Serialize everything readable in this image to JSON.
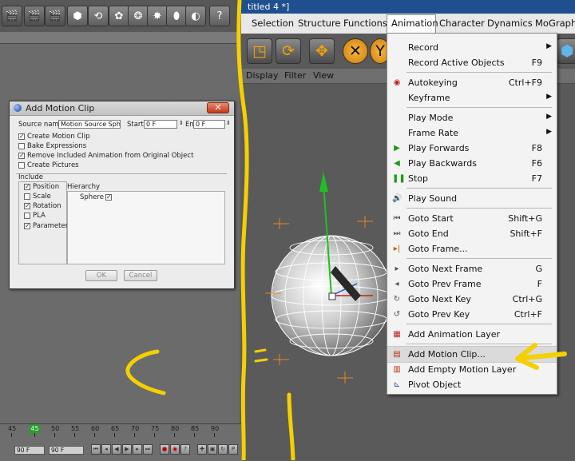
{
  "window": {
    "title_fragment": "titled 4 *]"
  },
  "menubar": {
    "items": [
      "Selection",
      "Structure",
      "Functions",
      "Animation",
      "Character",
      "Dynamics",
      "MoGraph"
    ]
  },
  "viewport_menu": {
    "items": [
      "Display",
      "Filter",
      "View"
    ]
  },
  "animation_menu": {
    "items": [
      {
        "label": "Record",
        "shortcut": "",
        "submenu": true,
        "icon": ""
      },
      {
        "label": "Record Active Objects",
        "shortcut": "F9",
        "submenu": false,
        "icon": ""
      },
      {
        "label": "Autokeying",
        "shortcut": "Ctrl+F9",
        "submenu": false,
        "icon": "autokey-icon"
      },
      {
        "label": "Keyframe",
        "shortcut": "",
        "submenu": true,
        "icon": ""
      },
      {
        "label": "Play Mode",
        "shortcut": "",
        "submenu": true,
        "icon": ""
      },
      {
        "label": "Frame Rate",
        "shortcut": "",
        "submenu": true,
        "icon": ""
      },
      {
        "label": "Play Forwards",
        "shortcut": "F8",
        "submenu": false,
        "icon": "play-forward-icon"
      },
      {
        "label": "Play Backwards",
        "shortcut": "F6",
        "submenu": false,
        "icon": "play-backward-icon"
      },
      {
        "label": "Stop",
        "shortcut": "F7",
        "submenu": false,
        "icon": "stop-icon"
      },
      {
        "label": "Play Sound",
        "shortcut": "",
        "submenu": false,
        "icon": "sound-icon"
      },
      {
        "label": "Goto Start",
        "shortcut": "Shift+G",
        "submenu": false,
        "icon": "goto-start-icon"
      },
      {
        "label": "Goto End",
        "shortcut": "Shift+F",
        "submenu": false,
        "icon": "goto-end-icon"
      },
      {
        "label": "Goto Frame...",
        "shortcut": "",
        "submenu": false,
        "icon": "goto-frame-icon"
      },
      {
        "label": "Goto Next Frame",
        "shortcut": "G",
        "submenu": false,
        "icon": "next-frame-icon"
      },
      {
        "label": "Goto Prev Frame",
        "shortcut": "F",
        "submenu": false,
        "icon": "prev-frame-icon"
      },
      {
        "label": "Goto Next Key",
        "shortcut": "Ctrl+G",
        "submenu": false,
        "icon": "next-key-icon"
      },
      {
        "label": "Goto Prev Key",
        "shortcut": "Ctrl+F",
        "submenu": false,
        "icon": "prev-key-icon"
      },
      {
        "label": "Add Animation Layer",
        "shortcut": "",
        "submenu": false,
        "icon": "animation-layer-icon"
      },
      {
        "label": "Add Motion Clip...",
        "shortcut": "",
        "submenu": false,
        "icon": "motion-clip-icon",
        "highlighted": true
      },
      {
        "label": "Add Empty Motion Layer",
        "shortcut": "",
        "submenu": false,
        "icon": "empty-motion-layer-icon"
      },
      {
        "label": "Pivot Object",
        "shortcut": "",
        "submenu": false,
        "icon": "pivot-object-icon"
      }
    ]
  },
  "dialog": {
    "title": "Add Motion Clip",
    "source_name_label": "Source name",
    "source_name_value": "Motion Source Sphere",
    "start_label": "Start",
    "start_value": "0 F",
    "end_label": "End",
    "end_value": "0 F",
    "options": [
      {
        "label": "Create Motion Clip",
        "checked": true
      },
      {
        "label": "Bake Expressions",
        "checked": false
      },
      {
        "label": "Remove Included Animation from Original Object",
        "checked": true
      },
      {
        "label": "Create Pictures",
        "checked": false
      }
    ],
    "include_label": "Include",
    "include_items": [
      {
        "label": "Position",
        "checked": true
      },
      {
        "label": "Scale",
        "checked": false
      },
      {
        "label": "Rotation",
        "checked": true
      },
      {
        "label": "PLA",
        "checked": false
      },
      {
        "label": "Parameter",
        "checked": true
      }
    ],
    "hierarchy_label": "Hierarchy",
    "hierarchy_item": "Sphere",
    "ok_label": "OK",
    "cancel_label": "Cancel"
  },
  "timeline": {
    "ticks": [
      "45",
      "45",
      "50",
      "55",
      "60",
      "65",
      "70",
      "75",
      "80",
      "85",
      "90"
    ],
    "current_frame": "45",
    "start_field": "90 F",
    "end_field": "90 F"
  }
}
